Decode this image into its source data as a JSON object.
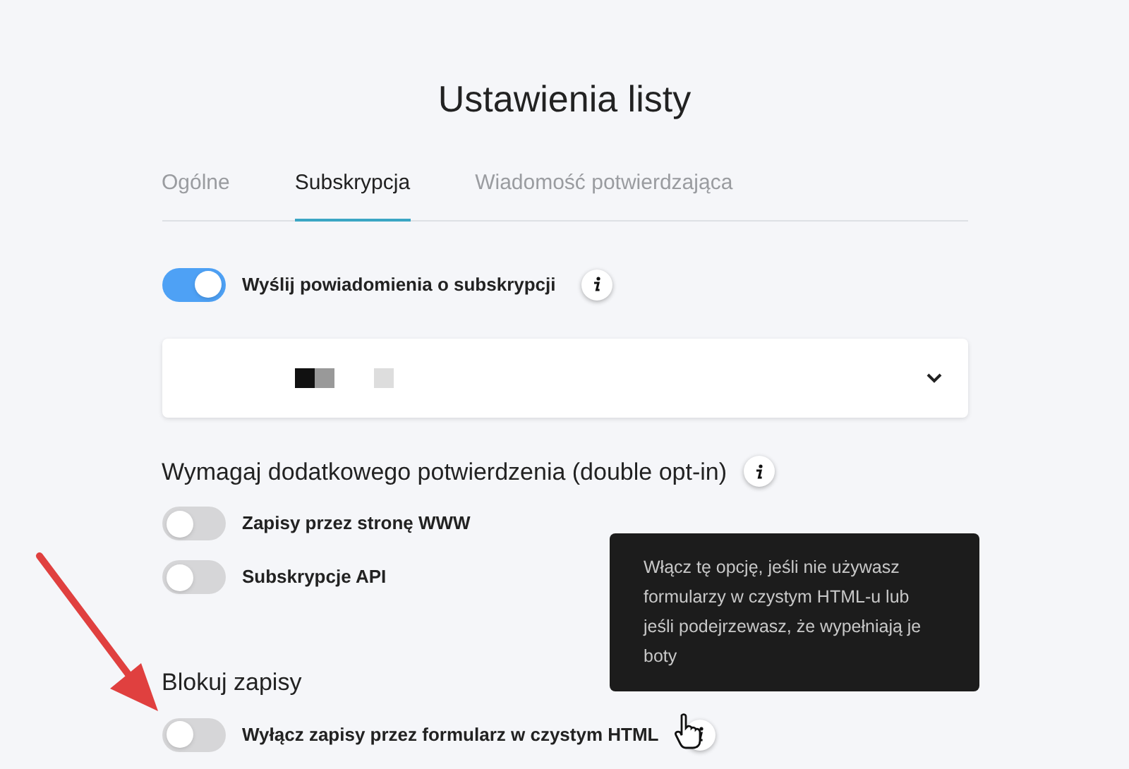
{
  "title": "Ustawienia listy",
  "tabs": [
    {
      "label": "Ogólne",
      "selected": false
    },
    {
      "label": "Subskrypcja",
      "selected": true
    },
    {
      "label": "Wiadomość potwierdzająca",
      "selected": false
    }
  ],
  "notify": {
    "label": "Wyślij powiadomienia o subskrypcji",
    "on": true
  },
  "sections": [
    {
      "heading": "Wymagaj dodatkowego potwierdzenia (double opt-in)",
      "toggles": [
        {
          "label": "Zapisy przez stronę WWW",
          "on": false
        },
        {
          "label": "Subskrypcje API",
          "on": false
        }
      ]
    },
    {
      "heading": "Blokuj zapisy",
      "toggles": [
        {
          "label": "Wyłącz zapisy przez formularz w czystym HTML",
          "on": false,
          "info": true
        }
      ]
    }
  ],
  "tooltip": {
    "text": "Włącz tę opcję, jeśli nie używasz formularzy w czystym HTML-u lub jeśli podejrzewasz, że wypełniają je boty"
  }
}
